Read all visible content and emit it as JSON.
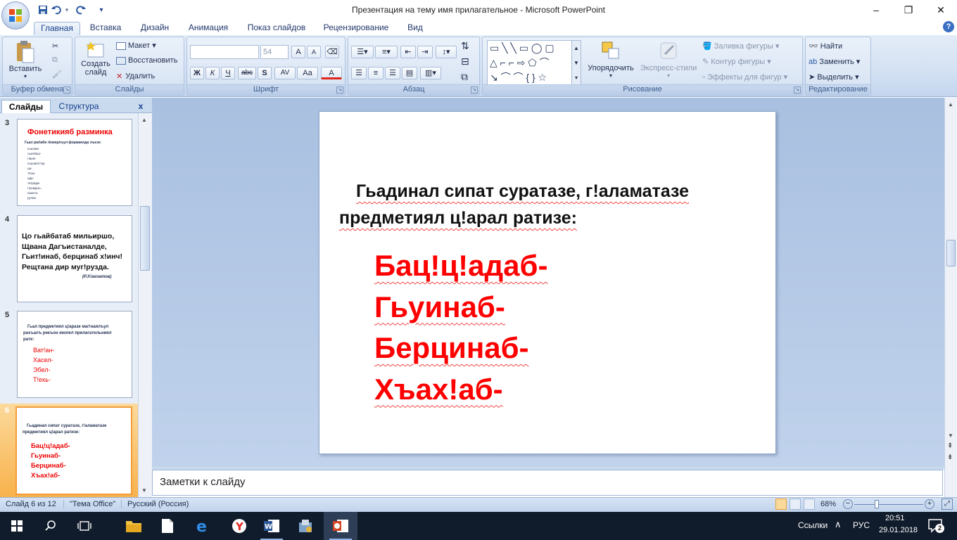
{
  "window": {
    "title": "Презентация на тему имя прилагательное - Microsoft PowerPoint",
    "controls": [
      "–",
      "❐",
      "✕"
    ]
  },
  "qat": {
    "save_icon": "save-icon",
    "undo_icon": "undo-icon",
    "redo_icon": "redo-icon",
    "customize": "▾"
  },
  "ribbon_tabs": [
    "Главная",
    "Вставка",
    "Дизайн",
    "Анимация",
    "Показ слайдов",
    "Рецензирование",
    "Вид"
  ],
  "ribbon": {
    "clipboard": {
      "label": "Буфер обмена",
      "paste": "Вставить"
    },
    "slides": {
      "label": "Слайды",
      "new_slide_1": "Создать",
      "new_slide_2": "слайд",
      "layout": "Макет",
      "reset": "Восстановить",
      "delete": "Удалить"
    },
    "font": {
      "label": "Шрифт",
      "font_name": "",
      "font_size": "54",
      "grow": "A",
      "shrink": "A",
      "bold": "Ж",
      "italic": "К",
      "underline": "Ч",
      "strike": "abc",
      "shadow": "S",
      "spacing": "AV",
      "case": "Aa",
      "color": "A"
    },
    "paragraph": {
      "label": "Абзац"
    },
    "drawing": {
      "label": "Рисование",
      "arrange": "Упорядочить",
      "quick_styles": "Экспресс-стили",
      "fill": "Заливка фигуры",
      "outline": "Контур фигуры",
      "effects": "Эффекты для фигур"
    },
    "editing": {
      "label": "Редактирование",
      "find": "Найти",
      "replace": "Заменить",
      "select": "Выделить"
    }
  },
  "panel": {
    "tab_slides": "Слайды",
    "tab_outline": "Структура",
    "close": "x"
  },
  "thumbnails": [
    {
      "num": "3",
      "title": "Фонетикияб  разминка",
      "subtitle": "Гьал рагIаби гIемерлъул формаялда лъезе:",
      "lines": [
        "къалам-",
        "гьалбац!-",
        "гIанк!-",
        "къали/нт'ар-",
        "ца-",
        "т!ехь-",
        "цир-",
        "тетради-",
        "г!ункрузь-",
        "пакета-",
        "ручка-"
      ]
    },
    {
      "num": "4",
      "lines": [
        "Цо гьайбатаб мильиршо,",
        "Щвана Дагъистаналде,",
        "Гьит!инаб, берцинаб х!инч!",
        "Рещтана дир муг!рузда."
      ],
      "author": "(Р.Х!амзатов)"
    },
    {
      "num": "5",
      "text1": "Гьал предметиял ц!аразе маг!наялъул",
      "text2": "рахъалъ рекъон кколел прилагательниял",
      "text3": "рате:",
      "words": [
        "Ват!ан-",
        "Хасел-",
        "Эбел-",
        "Т!ехь-"
      ]
    },
    {
      "num": "6",
      "text1": "Гьадинал сипат суратазе, г!аламатазе",
      "text2": "предметиял ц!арал ратизе:",
      "words": [
        "Бац!ц!адаб-",
        "Гьуинаб-",
        "Берцинаб-",
        "Хъах!аб-"
      ]
    }
  ],
  "slide": {
    "heading_line1": "Гьадинал сипат суратазе, г!аламатазе",
    "heading_line2": "предметиял ц!арал ратизе:",
    "words": [
      "Бац!ц!адаб-",
      "Гьуинаб-",
      "Берцинаб-",
      "Хъах!аб-"
    ],
    "word_color": "#ff0000"
  },
  "notes": {
    "text": "Заметки к слайду"
  },
  "status": {
    "slide_pos": "Слайд 6 из 12",
    "theme": "\"Тема Office\"",
    "language": "Русский (Россия)",
    "zoom": "68%",
    "zoom_value": 0.68
  },
  "taskbar": {
    "apps": [
      "windows-start",
      "search",
      "task-view",
      "file-explorer",
      "notepad",
      "edge",
      "yandex-browser",
      "word",
      "uninstaller",
      "powerpoint"
    ],
    "links": "Ссылки",
    "lang": "РУС",
    "time": "20:51",
    "date": "29.01.2018",
    "notifications": "2"
  }
}
